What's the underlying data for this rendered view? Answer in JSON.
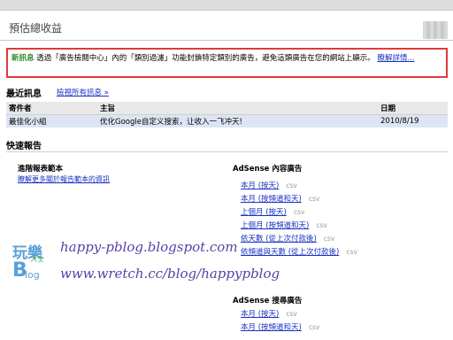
{
  "header": {
    "title": "預估總收益"
  },
  "alert": {
    "prefix": "新訊息",
    "body": "透過「廣告檢閱中心」內的「類別過濾」功能封鎖特定類別的廣告，避免這類廣告在您的網站上顯示。",
    "link": "瞭解詳情..."
  },
  "messages": {
    "title": "最近訊息",
    "view_all": "檢視所有訊息 »",
    "columns": [
      "寄件者",
      "主旨",
      "日期"
    ],
    "rows": [
      [
        "最佳化小組",
        "优化Google自定义搜索，让收入一飞冲天!",
        "2010/8/19"
      ]
    ]
  },
  "quick_reports": {
    "title": "快速報告",
    "left_title": "進階報表範本",
    "left_link": "瞭解更多關於報告範本的資訊",
    "content_ads": {
      "title": "AdSense 內容廣告",
      "items": [
        "本月 (按天)",
        "本月 (按頻道和天)",
        "上個月 (按天)",
        "上個月 (按頻道和天)",
        "依天數 (從上次付款後)",
        "依頻道與天數 (從上次付款後)"
      ],
      "csv_label": "csv"
    },
    "search_ads": {
      "title": "AdSense 搜尋廣告",
      "items": [
        "本月 (按天)",
        "本月 (按頻道和天)"
      ],
      "csv_label": "csv"
    }
  },
  "watermark": {
    "logo_top": "玩樂",
    "logo_mid": "大全",
    "logo_b": "B",
    "logo_blog": "log",
    "line1": "happy-pblog.blogspot.com",
    "line2": "www.wretch.cc/blog/happypblog"
  }
}
